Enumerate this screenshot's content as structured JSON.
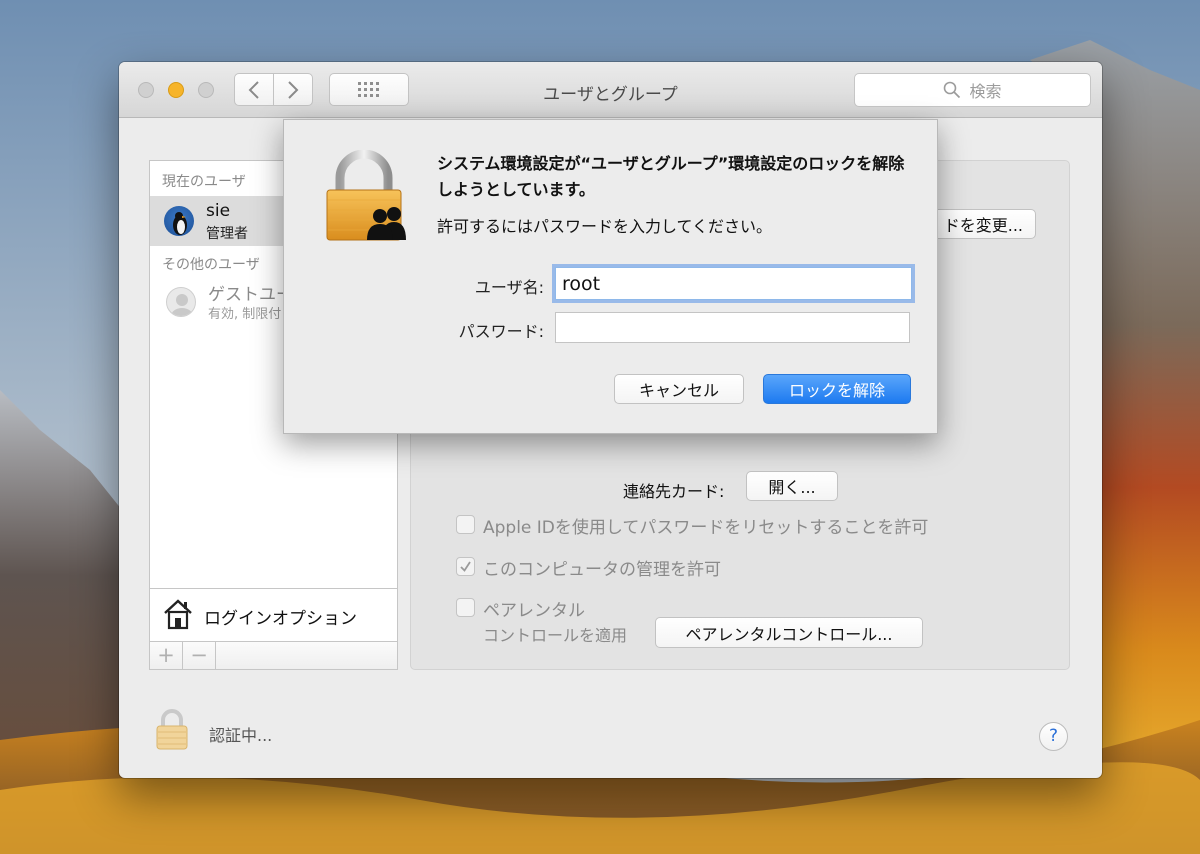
{
  "window": {
    "title": "ユーザとグループ",
    "search_placeholder": "検索"
  },
  "user_list": {
    "current_header": "現在のユーザ",
    "current_user": {
      "name": "sie",
      "role": "管理者"
    },
    "other_header": "その他のユーザ",
    "guest_user": {
      "name": "ゲストユー",
      "subtitle": "有効, 制限付"
    },
    "login_options_label": "ログインオプション",
    "add_symbol": "+",
    "remove_symbol": "−"
  },
  "detail": {
    "change_password_label": "ドを変更...",
    "contact_card_label": "連絡先カード:",
    "contact_open_label": "開く...",
    "checkboxes": [
      {
        "label": "Apple IDを使用してパスワードをリセットすることを許可",
        "checked": false
      },
      {
        "label": "このコンピュータの管理を許可",
        "checked": true
      },
      {
        "label": "ペアレンタル",
        "checked": false
      }
    ],
    "parental_line2": "コントロールを適用",
    "parental_button_label": "ペアレンタルコントロール..."
  },
  "footer": {
    "auth_status": "認証中...",
    "help_symbol": "?"
  },
  "auth_sheet": {
    "message": "システム環境設定が“ユーザとグループ”環境設定のロックを解除しようとしています。",
    "submessage": "許可するにはパスワードを入力してください。",
    "username_label": "ユーザ名:",
    "username_value": "root",
    "password_label": "パスワード:",
    "password_value": "",
    "cancel_label": "キャンセル",
    "unlock_label": "ロックを解除"
  },
  "colors": {
    "accent_blue": "#1d7af0",
    "traffic_minimize": "#f6b42a",
    "lock_gold": "#e9a93a"
  }
}
